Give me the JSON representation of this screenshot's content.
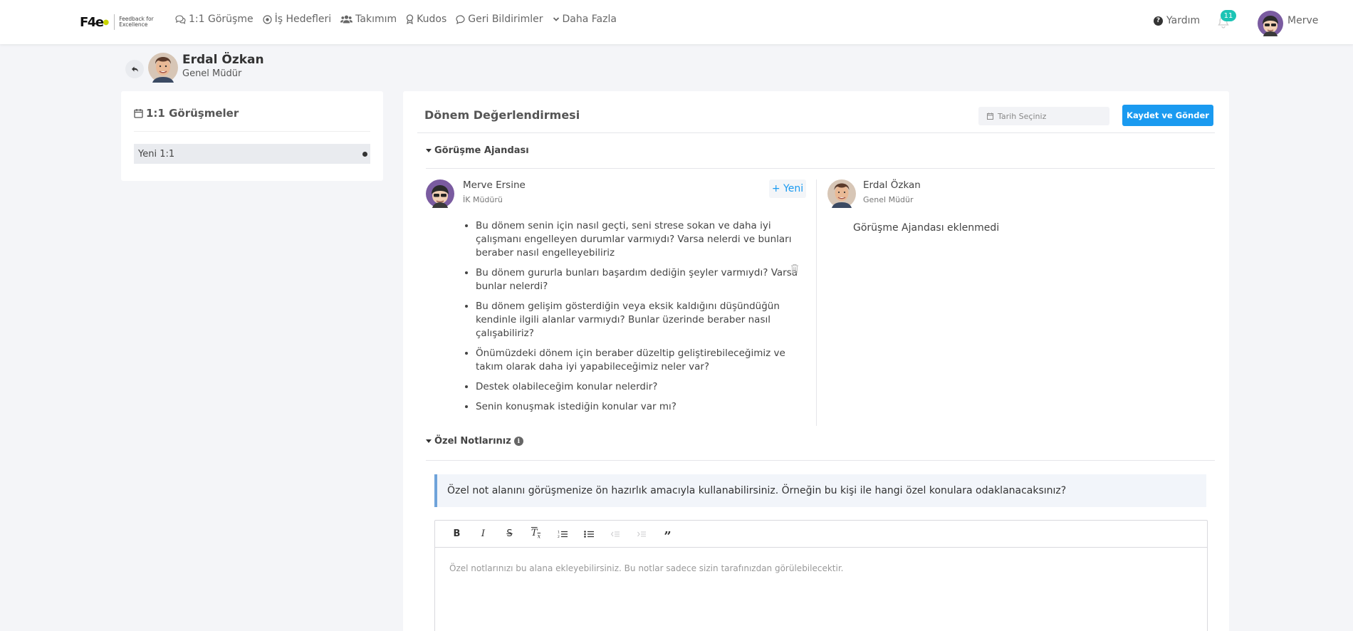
{
  "nav": {
    "logo_mark": "F4e",
    "logo_text": "Feedback for Excellence",
    "items": [
      {
        "label": "1:1 Görüşme",
        "icon": "chat-icon"
      },
      {
        "label": "İş Hedefleri",
        "icon": "target-icon"
      },
      {
        "label": "Takımım",
        "icon": "users-icon"
      },
      {
        "label": "Kudos",
        "icon": "award-icon"
      },
      {
        "label": "Geri Bildirimler",
        "icon": "comment-icon"
      },
      {
        "label": "Daha Fazla",
        "icon": "chevron-down-icon"
      }
    ],
    "help_label": "Yardım",
    "notification_count": "11",
    "user_name": "Merve"
  },
  "person": {
    "name": "Erdal Özkan",
    "title": "Genel Müdür"
  },
  "sidebar": {
    "title": "1:1 Görüşmeler",
    "items": [
      {
        "label": "Yeni 1:1"
      }
    ]
  },
  "main": {
    "title": "Dönem Değerlendirmesi",
    "date_placeholder": "Tarih Seçiniz",
    "save_label": "Kaydet ve Gönder",
    "agenda": {
      "title": "Görüşme Ajandası",
      "left": {
        "name": "Merve Ersine",
        "role": "İK Müdürü",
        "new_label": "+ Yeni",
        "items": [
          "Bu dönem senin için nasıl geçti, seni strese sokan ve daha iyi çalışmanı engelleyen durumlar varmıydı? Varsa nelerdi ve bunları beraber nasıl engelleyebiliriz",
          "Bu dönem gururla bunları başardım dediğin şeyler varmıydı? Varsa bunlar nelerdi?",
          "Bu dönem gelişim gösterdiğin veya eksik kaldığını düşündüğün kendinle ilgili alanlar varmıydı? Bunlar üzerinde beraber nasıl çalışabiliriz?",
          "Önümüzdeki dönem için beraber düzeltip geliştirebileceğimiz ve takım olarak daha iyi yapabileceğimiz neler var?",
          "Destek olabileceğim konular nelerdir?",
          "Senin konuşmak istediğin konular var mı?"
        ]
      },
      "right": {
        "name": "Erdal Özkan",
        "role": "Genel Müdür",
        "empty_text": "Görüşme Ajandası eklenmedi"
      }
    },
    "notes": {
      "title": "Özel Notlarınız",
      "notice": "Özel not alanını görüşmenize ön hazırlık amacıyla kullanabilirsiniz. Örneğin bu kişi ile hangi özel konulara odaklanacaksınız?",
      "placeholder": "Özel notlarınızı bu alana ekleyebilirsiniz. Bu notlar sadece sizin tarafınızdan görülebilecektir.",
      "toolbar": [
        "bold-icon",
        "italic-icon",
        "strikethrough-icon",
        "clear-format-icon",
        "ordered-list-icon",
        "bullet-list-icon",
        "outdent-icon",
        "indent-icon",
        "quote-icon"
      ]
    }
  },
  "colors": {
    "accent": "#1a9af0",
    "badge": "#1cc4b5",
    "notice_border": "#6fa3da"
  }
}
